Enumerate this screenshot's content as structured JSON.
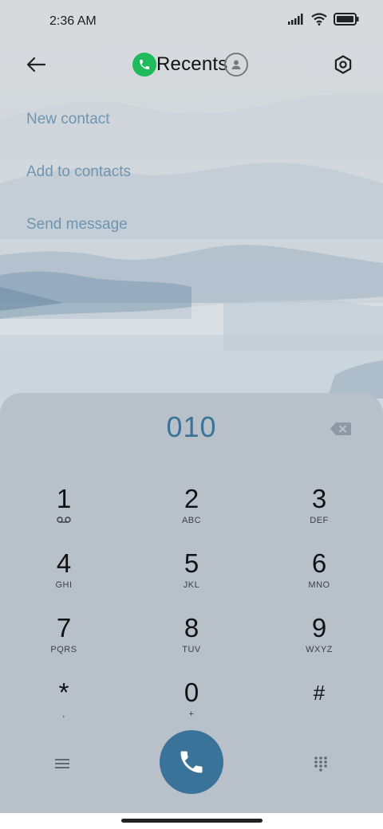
{
  "status_bar": {
    "time": "2:36 AM",
    "icons": [
      "signal-icon",
      "wifi-icon",
      "battery-icon"
    ]
  },
  "header": {
    "title": "Recents",
    "back_icon": "arrow-left-icon",
    "settings_icon": "settings-hexagon-icon",
    "phone_icon": "phone-icon",
    "contacts_icon": "contact-icon"
  },
  "actions": [
    {
      "label": "New contact"
    },
    {
      "label": "Add to contacts"
    },
    {
      "label": "Send message"
    }
  ],
  "dialpad": {
    "number": "010",
    "backspace_icon": "backspace-icon",
    "keys": [
      {
        "digit": "1",
        "letters": "",
        "icon": "voicemail-icon"
      },
      {
        "digit": "2",
        "letters": "ABC"
      },
      {
        "digit": "3",
        "letters": "DEF"
      },
      {
        "digit": "4",
        "letters": "GHI"
      },
      {
        "digit": "5",
        "letters": "JKL"
      },
      {
        "digit": "6",
        "letters": "MNO"
      },
      {
        "digit": "7",
        "letters": "PQRS"
      },
      {
        "digit": "8",
        "letters": "TUV"
      },
      {
        "digit": "9",
        "letters": "WXYZ"
      },
      {
        "digit": "*",
        "letters": ","
      },
      {
        "digit": "0",
        "letters": "+"
      },
      {
        "digit": "#",
        "letters": ""
      }
    ],
    "bottom": {
      "menu_icon": "menu-lines-icon",
      "call_icon": "phone-call-icon",
      "grid_icon": "dialpad-grid-icon"
    }
  },
  "colors": {
    "accent": "#3a7399",
    "action_text": "#6f95b0",
    "dialpad_bg": "#b8c1ca",
    "phone_green": "#1fba5b"
  }
}
